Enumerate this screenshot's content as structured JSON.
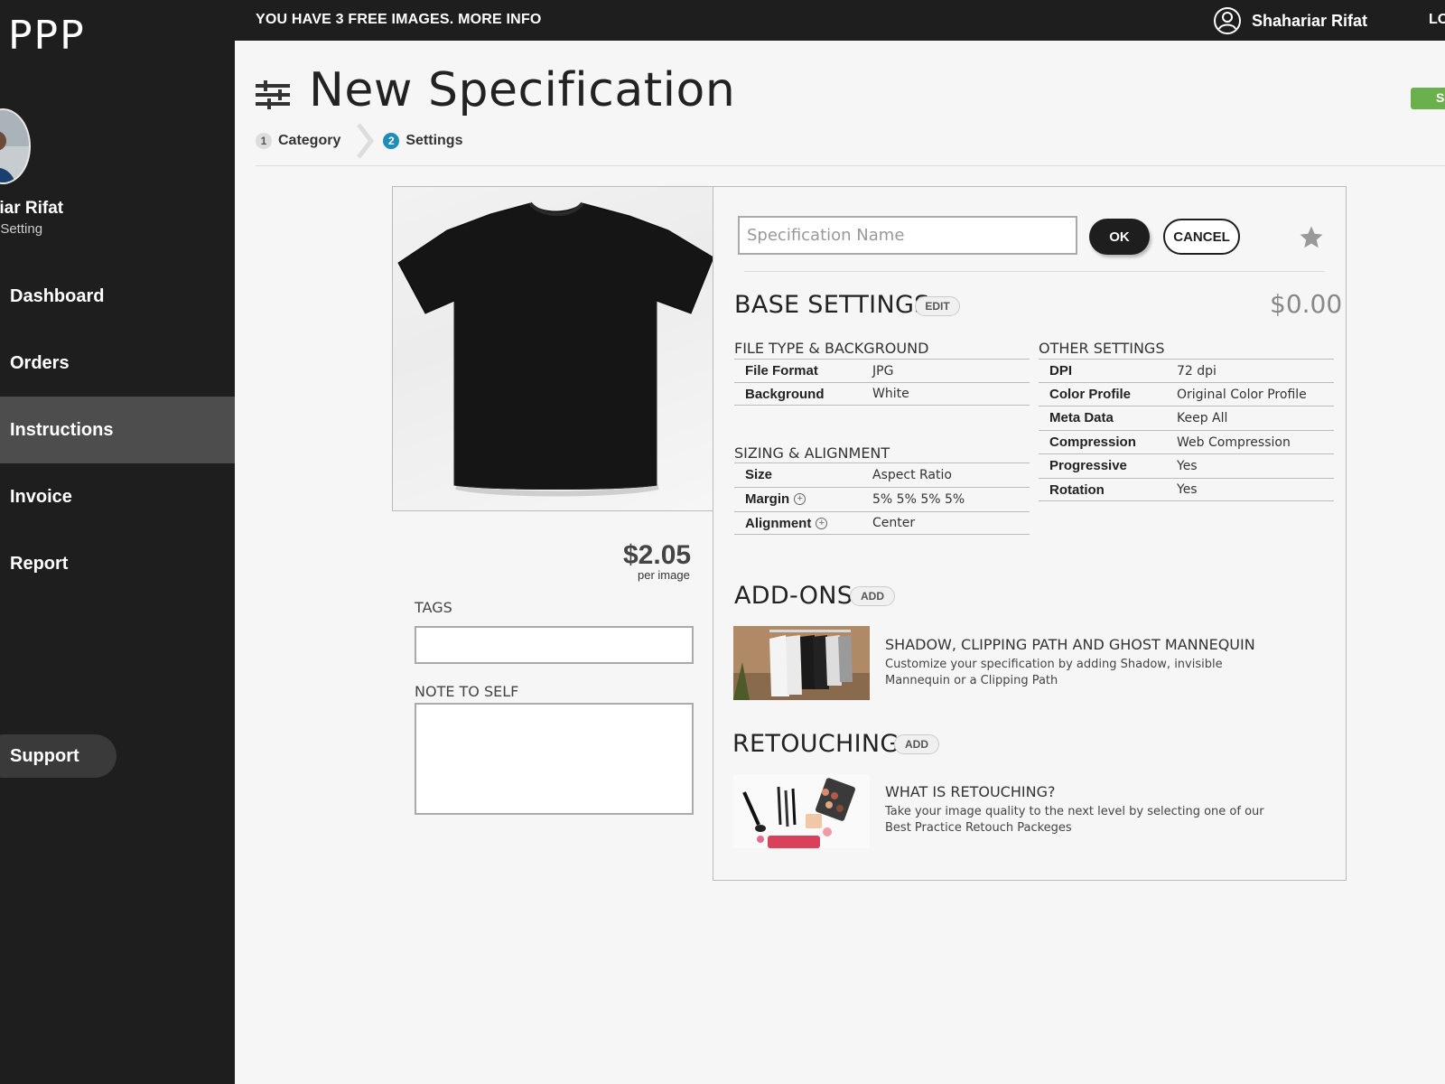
{
  "topbar": {
    "notice": "YOU HAVE 3 FREE IMAGES. MORE INFO",
    "user_name": "Shahariar Rifat",
    "logout_label": "LO"
  },
  "sidebar": {
    "logo": "PPP",
    "profile_name": "riar Rifat",
    "profile_sub": "t Setting",
    "items": [
      {
        "label": "Dashboard"
      },
      {
        "label": "Orders"
      },
      {
        "label": "Instructions",
        "active": true
      },
      {
        "label": "Invoice"
      },
      {
        "label": "Report"
      }
    ],
    "support_label": "Support"
  },
  "header": {
    "title": "New Specification",
    "save_label": "Sa",
    "steps": [
      {
        "num": "1",
        "label": "Category"
      },
      {
        "num": "2",
        "label": "Settings",
        "active": true
      }
    ]
  },
  "product": {
    "price": "$2.05",
    "price_unit": "per image",
    "tags_label": "TAGS",
    "tags_value": "",
    "note_label": "NOTE TO SELF",
    "note_value": ""
  },
  "spec": {
    "name_placeholder": "Specification Name",
    "name_value": "",
    "ok_label": "OK",
    "cancel_label": "CANCEL",
    "favorite_icon": "star-icon"
  },
  "base_settings": {
    "title": "BASE SETTINGS",
    "edit_label": "EDIT",
    "total": "$0.00",
    "file_group": {
      "title": "FILE TYPE & BACKGROUND",
      "rows": [
        {
          "key": "File Format",
          "value": "JPG"
        },
        {
          "key": "Background",
          "value": "White"
        }
      ]
    },
    "sizing_group": {
      "title": "SIZING & ALIGNMENT",
      "rows": [
        {
          "key": "Size",
          "value": "Aspect Ratio"
        },
        {
          "key": "Margin",
          "value": "5% 5% 5% 5%"
        },
        {
          "key": "Alignment",
          "value": "Center"
        }
      ]
    },
    "other_group": {
      "title": "OTHER SETTINGS",
      "rows": [
        {
          "key": "DPI",
          "value": "72 dpi"
        },
        {
          "key": "Color Profile",
          "value": "Original Color Profile"
        },
        {
          "key": "Meta Data",
          "value": "Keep All"
        },
        {
          "key": "Compression",
          "value": "Web Compression"
        },
        {
          "key": "Progressive",
          "value": "Yes"
        },
        {
          "key": "Rotation",
          "value": "Yes"
        }
      ]
    }
  },
  "addons": {
    "title": "ADD-ONS",
    "add_label": "ADD",
    "item_title": "SHADOW, CLIPPING PATH AND GHOST MANNEQUIN",
    "item_desc": "Customize your specification by adding Shadow, invisible Mannequin or a Clipping Path"
  },
  "retouching": {
    "title": "RETOUCHING",
    "add_label": "ADD",
    "item_title": "WHAT IS RETOUCHING?",
    "item_desc": "Take your image quality to the next level by selecting one of our Best Practice Retouch Packeges"
  },
  "colors": {
    "sidebar_bg": "#1e1e1e",
    "active_nav": "#4d4d4d",
    "accent_step": "#1f8db8",
    "save_green": "#6ab04c"
  }
}
